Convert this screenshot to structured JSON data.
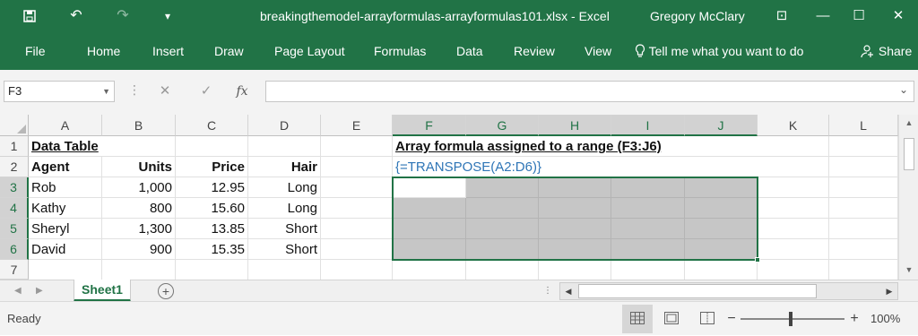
{
  "titlebar": {
    "filename": "breakingthemodel-arrayformulas-arrayformulas101.xlsx",
    "separator": " - ",
    "app": "Excel",
    "user": "Gregory McClary",
    "quick_access": {
      "save": "save-icon",
      "undo": "↶",
      "redo": "↷",
      "customize": "▾"
    },
    "window_buttons": {
      "ribbon_display": "⊡",
      "minimize": "—",
      "maximize": "☐",
      "close": "✕"
    }
  },
  "ribbon": {
    "tabs": [
      "File",
      "Home",
      "Insert",
      "Draw",
      "Page Layout",
      "Formulas",
      "Data",
      "Review",
      "View"
    ],
    "tell_me": "Tell me what you want to do",
    "share": "Share"
  },
  "formula_bar": {
    "name_box": "F3",
    "formula": "",
    "cancel_icon": "✕",
    "enter_icon": "✓",
    "fx": "fx"
  },
  "sheet": {
    "columns": [
      "A",
      "B",
      "C",
      "D",
      "E",
      "F",
      "G",
      "H",
      "I",
      "J",
      "K",
      "L"
    ],
    "selected_columns": [
      "F",
      "G",
      "H",
      "I",
      "J"
    ],
    "rows": [
      "1",
      "2",
      "3",
      "4",
      "5",
      "6",
      "7"
    ],
    "selected_rows": [
      "3",
      "4",
      "5",
      "6"
    ],
    "active_cell": "F3",
    "selection_range": "F3:J6",
    "cells": {
      "A1": "Data Table",
      "F1": "Array formula assigned to a range (F3:J6)",
      "A2": "Agent",
      "B2": "Units",
      "C2": "Price",
      "D2": "Hair",
      "F2": "{=TRANSPOSE(A2:D6)}",
      "A3": "Rob",
      "B3": "1,000",
      "C3": "12.95",
      "D3": "Long",
      "A4": "Kathy",
      "B4": "800",
      "C4": "15.60",
      "D4": "Long",
      "A5": "Sheryl",
      "B5": "1,300",
      "C5": "13.85",
      "D5": "Short",
      "A6": "David",
      "B6": "900",
      "C6": "15.35",
      "D6": "Short"
    }
  },
  "sheet_tabs": {
    "active": "Sheet1",
    "add_label": "+"
  },
  "statusbar": {
    "status": "Ready",
    "zoom_minus": "−",
    "zoom_plus": "+",
    "zoom": "100%"
  },
  "colors": {
    "accent": "#217346",
    "selection_fill": "#c6c6c6",
    "formula_text": "#2e75b6"
  }
}
